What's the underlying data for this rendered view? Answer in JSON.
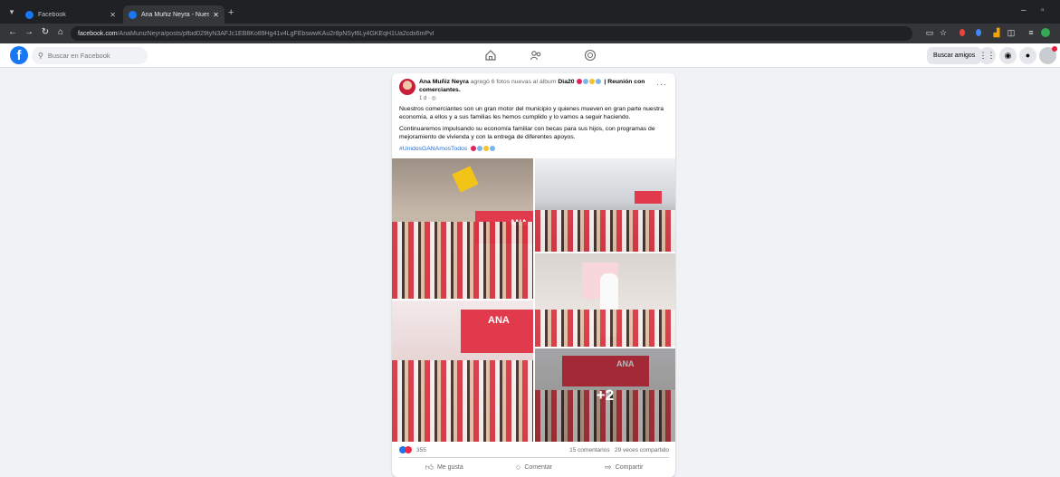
{
  "browser": {
    "tabs": [
      {
        "label": "Facebook",
        "active": false
      },
      {
        "label": "Ana Muñiz Neyra - Nuestros co",
        "active": true
      }
    ],
    "url_host": "facebook.com",
    "url_path": "/AnaMunizNeyra/posts/pfbid029tyN3AFJc1EB8Ko89Hg41v4LgFEbswwKAu2r8pNSyf6Ly4GKEqH1Ua2cdx6mPvl"
  },
  "fb": {
    "search_placeholder": "Buscar en Facebook",
    "find_friends": "Buscar amigos",
    "colors": {
      "brand": "#1877f2",
      "link": "#216fdb",
      "notification": "#e41e3f"
    }
  },
  "post": {
    "author": "Ana Muñiz Neyra",
    "action": "agregó 6 fotos nuevas al álbum",
    "album": "Dia20",
    "album_suffix": "| Reunión con comerciantes.",
    "time": "1 d",
    "paragraph1": "Nuestros comerciantes son un gran motor del municipio y quienes mueven en gran parte nuestra economía, a ellos y a sus familias les hemos cumplido y lo vamos a seguir haciendo.",
    "paragraph2": "Continuaremos impulsando su economía familiar con becas para sus hijos, con programas de mejoramiento de vivienda y con la entrega de diferentes apoyos.",
    "hashtag": "#UnidosGANAmosTodos",
    "photos": {
      "banner_name": "ANA",
      "more_count": "+2"
    },
    "reactions_count": "355",
    "comments": "15 comentarios",
    "shares": "29 veces compartido",
    "actions": {
      "like": "Me gusta",
      "comment": "Comentar",
      "share": "Compartir"
    }
  }
}
